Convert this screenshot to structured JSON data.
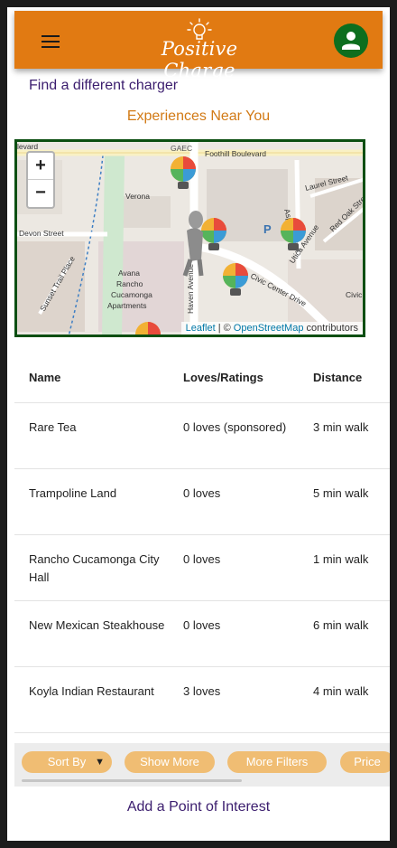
{
  "header": {
    "brand": "Positive Charge",
    "menu_icon": "hamburger-menu-icon",
    "avatar_icon": "user-icon",
    "colors": {
      "bar": "#e17a12",
      "avatar": "#0d6e1e"
    }
  },
  "find_link": "Find a different charger",
  "section_title": "Experiences Near You",
  "map": {
    "zoom_in": "+",
    "zoom_out": "−",
    "streets": [
      "Foothill Boulevard",
      "Laurel Street",
      "Red Oak Street",
      "Verona",
      "Devon Street",
      "Sunset Trail Place",
      "Avana Rancho Cucamonga Apartments",
      "Haven Avenue",
      "Civic Center Drive",
      "Utica Avenue",
      "Aspen Street",
      "Civic",
      "levard",
      "GAEC"
    ],
    "attribution": {
      "leaflet": "Leaflet",
      "sep": "| ©",
      "osm": "OpenStreetMap",
      "contributors": "contributors"
    }
  },
  "table": {
    "headers": [
      "Name",
      "Loves/Ratings",
      "Distance"
    ],
    "rows": [
      {
        "name": "Rare Tea",
        "loves": "0 loves (sponsored)",
        "distance": "3 min walk"
      },
      {
        "name": "Trampoline Land",
        "loves": "0 loves",
        "distance": "5 min walk"
      },
      {
        "name": "Rancho Cucamonga City Hall",
        "loves": "0 loves",
        "distance": "1 min walk"
      },
      {
        "name": "New Mexican Steakhouse",
        "loves": "0 loves",
        "distance": "6 min walk"
      },
      {
        "name": "Koyla Indian Restaurant",
        "loves": "3 loves",
        "distance": "4 min walk"
      }
    ]
  },
  "filters": {
    "sort_by": "Sort By",
    "show_more": "Show More",
    "more_filters": "More Filters",
    "price": "Price",
    "pill_color": "#f0bd73"
  },
  "add_poi": "Add a Point of Interest"
}
